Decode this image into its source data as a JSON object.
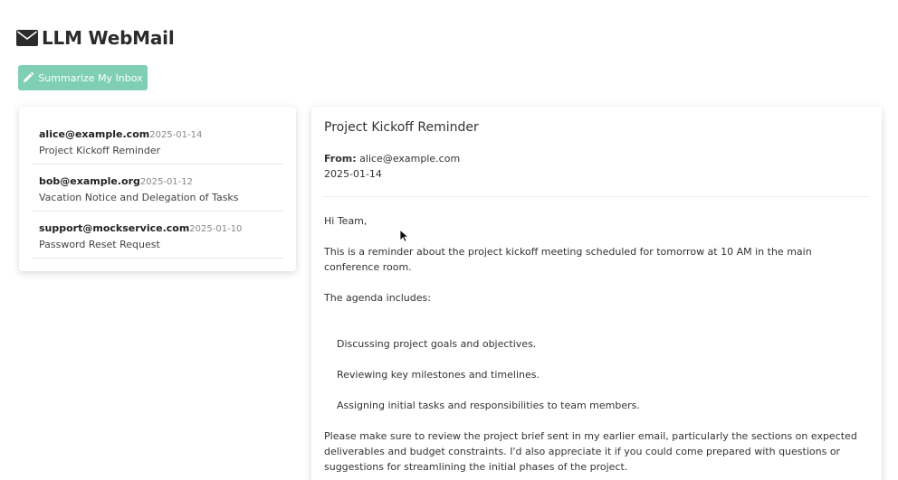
{
  "app": {
    "title": "LLM WebMail"
  },
  "toolbar": {
    "summarize_label": "Summarize My Inbox"
  },
  "colors": {
    "summarize_button": "#7fcfb4",
    "title": "#2b2b2b",
    "date_text": "#888888"
  },
  "icons": {
    "header": "envelope-icon",
    "summarize": "pencil-icon"
  },
  "inbox": {
    "items": [
      {
        "sender": "alice@example.com",
        "date": "2025-01-14",
        "subject": "Project Kickoff Reminder"
      },
      {
        "sender": "bob@example.org",
        "date": "2025-01-12",
        "subject": "Vacation Notice and Delegation of Tasks"
      },
      {
        "sender": "support@mockservice.com",
        "date": "2025-01-10",
        "subject": "Password Reset Request"
      }
    ]
  },
  "email": {
    "subject": "Project Kickoff Reminder",
    "from_label": "From:",
    "from": "alice@example.com",
    "date": "2025-01-14",
    "greeting": "Hi Team,",
    "paragraph1": "This is a reminder about the project kickoff meeting scheduled for tomorrow at 10 AM in the main conference room.",
    "paragraph2": "The agenda includes:",
    "agenda": [
      "Discussing project goals and objectives.",
      "Reviewing key milestones and timelines.",
      "Assigning initial tasks and responsibilities to team members."
    ],
    "paragraph3": "Please make sure to review the project brief sent in my earlier email, particularly the sections on expected deliverables and budget constraints. I'd also appreciate it if you could come prepared with questions or suggestions for streamlining the initial phases of the project."
  }
}
